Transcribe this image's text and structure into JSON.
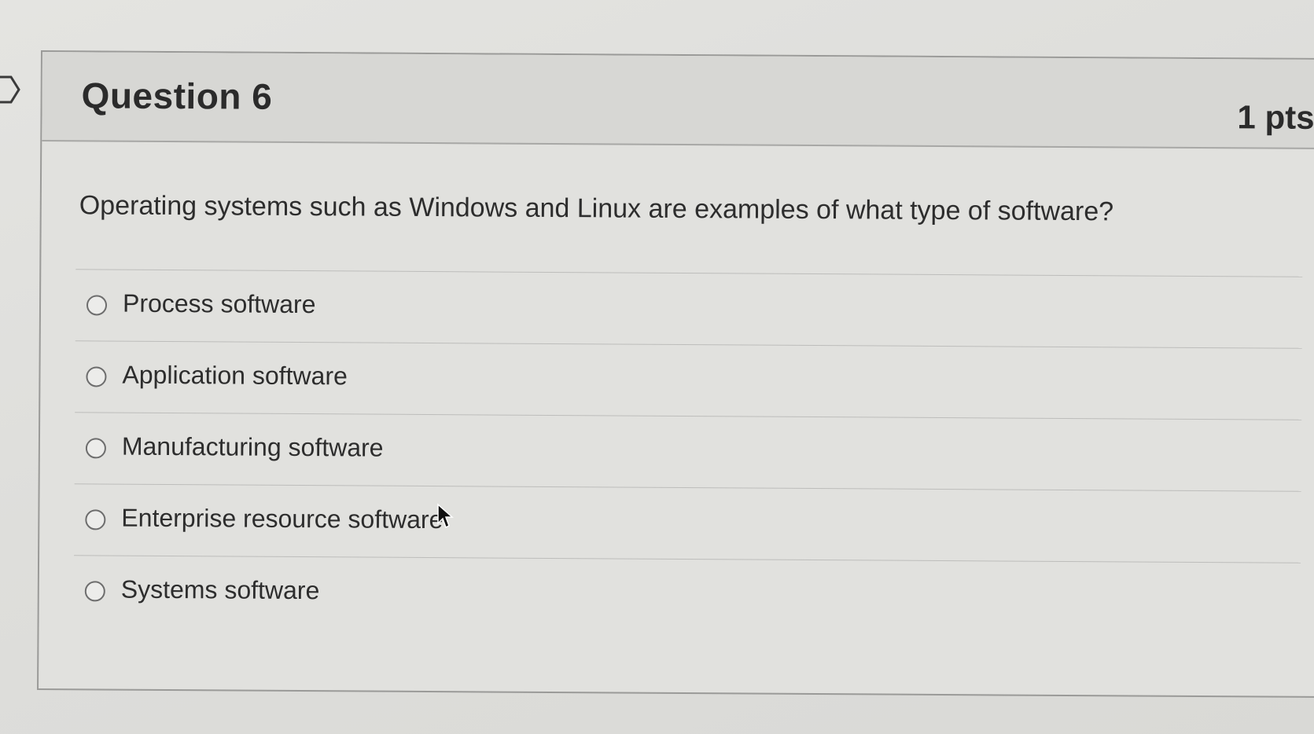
{
  "question": {
    "title": "Question 6",
    "points": "1 pts",
    "text": "Operating systems such as Windows and Linux are examples of what type of software?"
  },
  "answers": [
    {
      "label": "Process software"
    },
    {
      "label": "Application software"
    },
    {
      "label": "Manufacturing software"
    },
    {
      "label": "Enterprise resource software"
    },
    {
      "label": "Systems software"
    }
  ],
  "icons": {
    "flag": "bookmark-flag-icon",
    "cursor": "mouse-pointer-icon",
    "radio": "radio-button-unselected-icon"
  }
}
